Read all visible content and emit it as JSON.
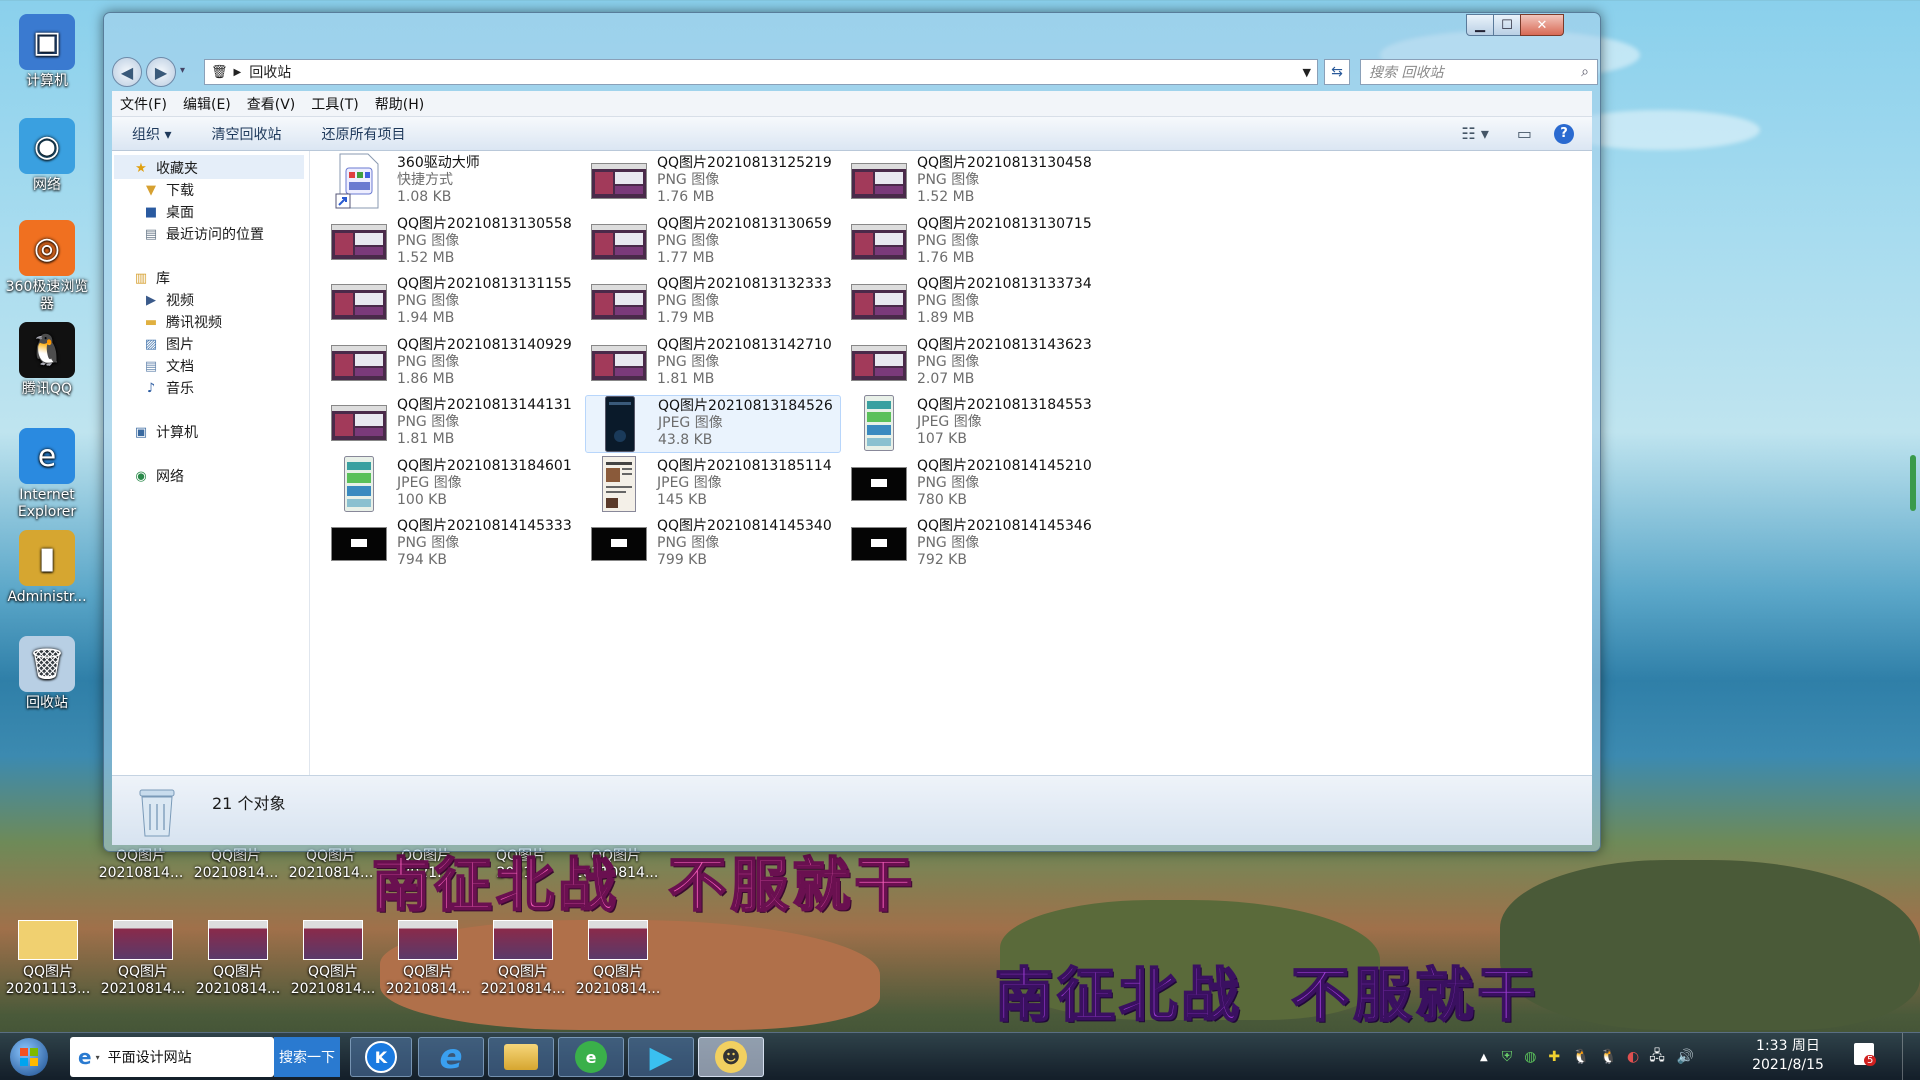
{
  "desktop": {
    "icons_left": [
      {
        "label": "计算机",
        "icon": "computer-icon"
      },
      {
        "label": "网络",
        "icon": "network-globe-icon"
      },
      {
        "label": "360极速浏览器",
        "icon": "360-browser-icon"
      },
      {
        "label": "腾讯QQ",
        "icon": "qq-penguin-icon"
      },
      {
        "label": "Internet Explorer",
        "icon": "ie-icon"
      },
      {
        "label": "Administr...",
        "icon": "user-folder-icon"
      },
      {
        "label": "回收站",
        "icon": "recycle-bin-icon"
      }
    ],
    "row_icons_mid": [
      {
        "line1": "QQ图片",
        "line2": "20210814..."
      },
      {
        "line1": "QQ图片",
        "line2": "20210814..."
      },
      {
        "line1": "QQ图片",
        "line2": "20210814..."
      },
      {
        "line1": "QQ图片",
        "line2": "2021..."
      },
      {
        "line1": "QQ图片",
        "line2": "2021..."
      },
      {
        "line1": "QQ图片",
        "line2": "20210814..."
      }
    ],
    "row_icons_bottom": [
      {
        "line1": "QQ图片",
        "line2": "20201113..."
      },
      {
        "line1": "QQ图片",
        "line2": "20210814..."
      },
      {
        "line1": "QQ图片",
        "line2": "20210814..."
      },
      {
        "line1": "QQ图片",
        "line2": "20210814..."
      },
      {
        "line1": "QQ图片",
        "line2": "20210814..."
      },
      {
        "line1": "QQ图片",
        "line2": "20210814..."
      },
      {
        "line1": "QQ图片",
        "line2": "20210814..."
      }
    ],
    "overlay_text_1": "南征北战  不服就干",
    "overlay_text_2": "南征北战  不服就干"
  },
  "window": {
    "address": "回收站",
    "search_placeholder": "搜索 回收站",
    "menu": [
      "文件(F)",
      "编辑(E)",
      "查看(V)",
      "工具(T)",
      "帮助(H)"
    ],
    "commands": {
      "organize": "组织 ▾",
      "empty": "清空回收站",
      "restore_all": "还原所有项目"
    },
    "nav": {
      "favorites": "收藏夹",
      "downloads": "下载",
      "desktop": "桌面",
      "recent": "最近访问的位置",
      "libraries": "库",
      "videos": "视频",
      "tencent_video": "腾讯视频",
      "pictures": "图片",
      "documents": "文档",
      "music": "音乐",
      "computer": "计算机",
      "network": "网络"
    },
    "files": [
      {
        "name": "360驱动大师",
        "type": "快捷方式",
        "size": "1.08 KB",
        "thumb": "shortcut"
      },
      {
        "name": "QQ图片20210813125219",
        "type": "PNG 图像",
        "size": "1.76 MB",
        "thumb": "screen"
      },
      {
        "name": "QQ图片20210813130458",
        "type": "PNG 图像",
        "size": "1.52 MB",
        "thumb": "screen"
      },
      {
        "name": "QQ图片20210813130558",
        "type": "PNG 图像",
        "size": "1.52 MB",
        "thumb": "screen"
      },
      {
        "name": "QQ图片20210813130659",
        "type": "PNG 图像",
        "size": "1.77 MB",
        "thumb": "screen"
      },
      {
        "name": "QQ图片20210813130715",
        "type": "PNG 图像",
        "size": "1.76 MB",
        "thumb": "screen"
      },
      {
        "name": "QQ图片20210813131155",
        "type": "PNG 图像",
        "size": "1.94 MB",
        "thumb": "screen"
      },
      {
        "name": "QQ图片20210813132333",
        "type": "PNG 图像",
        "size": "1.79 MB",
        "thumb": "screen"
      },
      {
        "name": "QQ图片20210813133734",
        "type": "PNG 图像",
        "size": "1.89 MB",
        "thumb": "screen"
      },
      {
        "name": "QQ图片20210813140929",
        "type": "PNG 图像",
        "size": "1.86 MB",
        "thumb": "screen"
      },
      {
        "name": "QQ图片20210813142710",
        "type": "PNG 图像",
        "size": "1.81 MB",
        "thumb": "screen"
      },
      {
        "name": "QQ图片20210813143623",
        "type": "PNG 图像",
        "size": "2.07 MB",
        "thumb": "screen"
      },
      {
        "name": "QQ图片20210813144131",
        "type": "PNG 图像",
        "size": "1.81 MB",
        "thumb": "screen"
      },
      {
        "name": "QQ图片20210813184526",
        "type": "JPEG 图像",
        "size": "43.8 KB",
        "thumb": "phone-dark",
        "selected": true
      },
      {
        "name": "QQ图片20210813184553",
        "type": "JPEG 图像",
        "size": "107 KB",
        "thumb": "phone-green"
      },
      {
        "name": "QQ图片20210813184601",
        "type": "JPEG 图像",
        "size": "100 KB",
        "thumb": "phone-green"
      },
      {
        "name": "QQ图片20210813185114",
        "type": "JPEG 图像",
        "size": "145 KB",
        "thumb": "doc"
      },
      {
        "name": "QQ图片20210814145210",
        "type": "PNG 图像",
        "size": "780 KB",
        "thumb": "black"
      },
      {
        "name": "QQ图片20210814145333",
        "type": "PNG 图像",
        "size": "794 KB",
        "thumb": "black"
      },
      {
        "name": "QQ图片20210814145340",
        "type": "PNG 图像",
        "size": "799 KB",
        "thumb": "black"
      },
      {
        "name": "QQ图片20210814145346",
        "type": "PNG 图像",
        "size": "792 KB",
        "thumb": "black"
      }
    ],
    "status": "21 个对象"
  },
  "taskbar": {
    "ie_title": "平面设计网站",
    "search_btn": "搜索一下",
    "clock_time": "1:33 周日",
    "clock_date": "2021/8/15",
    "notify_count": "5"
  }
}
